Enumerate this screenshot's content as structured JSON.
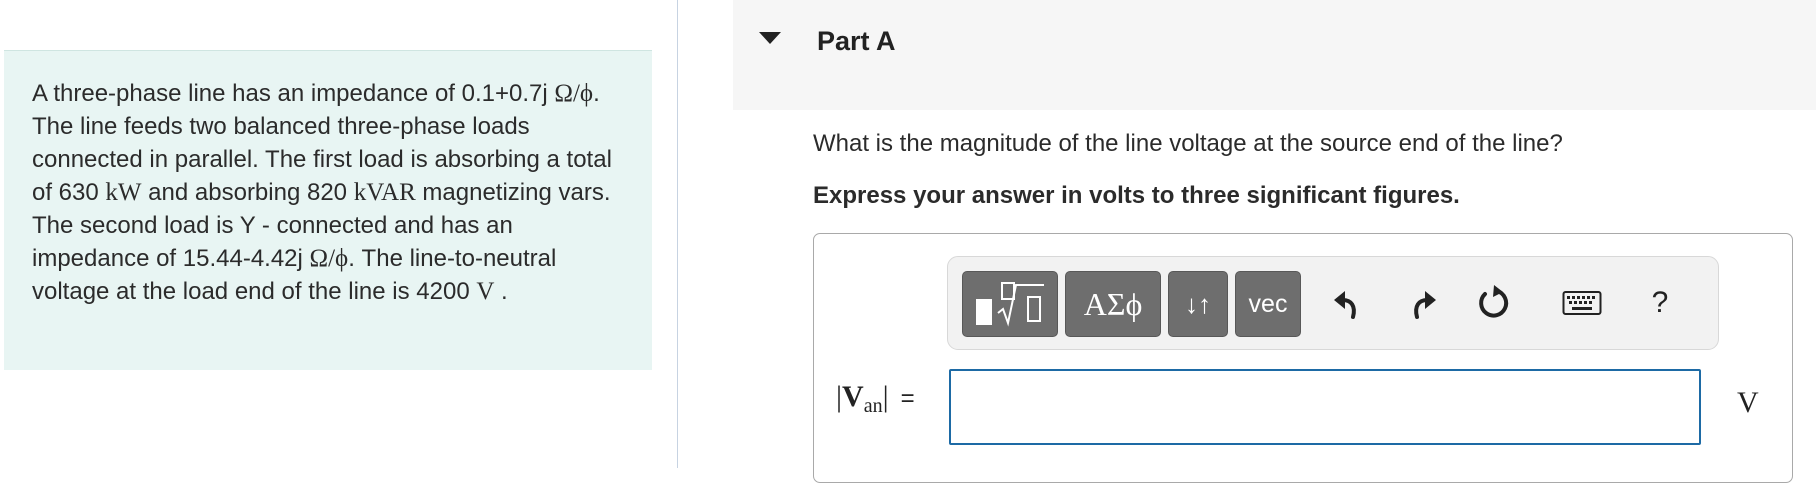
{
  "problem": {
    "text_1": "A three-phase line has an impedance of 0.1+0.7j ",
    "ohm_per_phase_1": "Ω/ϕ",
    "text_2": ". The line feeds two balanced three-phase loads connected in parallel. The first load is absorbing a total of 630 ",
    "unit_kw": "kW",
    "text_3": " and absorbing 820 ",
    "unit_kvar": "kVAR",
    "text_4": " magnetizing vars. The second load is Y - connected and has an impedance of 15.44-4.42j ",
    "ohm_per_phase_2": "Ω/ϕ",
    "text_5": ". The line-to-neutral voltage at the load end of the line is 4200 ",
    "unit_v": "V",
    "text_6": " ."
  },
  "part": {
    "title": "Part A"
  },
  "question": "What is the magnitude of the line voltage at the source end of the line?",
  "instruction": "Express your answer in volts to three significant figures.",
  "toolbar": {
    "greek_label": "ΑΣϕ",
    "arrows_label": "↓↑",
    "vec_label": "vec",
    "help_label": "?"
  },
  "answer": {
    "var_bar_left": "|",
    "var_symbol": "V",
    "var_subscript": "an",
    "var_bar_right": "|",
    "equals": "=",
    "value": "",
    "unit": "V"
  },
  "colors": {
    "problem_bg": "#e8f5f3",
    "header_bg": "#f6f6f6",
    "button_bg": "#6e6e6e",
    "input_border": "#1d6aa5"
  }
}
